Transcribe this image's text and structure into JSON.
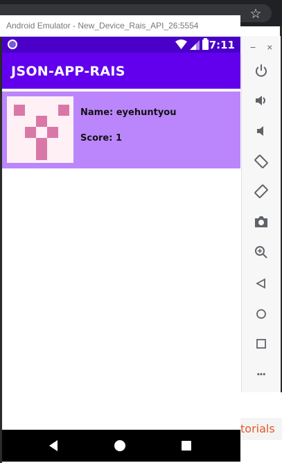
{
  "emulator": {
    "title": "Android Emulator - New_Device_Rais_API_26:5554"
  },
  "status_bar": {
    "time": "7:11"
  },
  "app": {
    "title": "JSON-APP-RAIS",
    "list": [
      {
        "name": "Name: eyehuntyou",
        "score": "Score: 1"
      }
    ]
  },
  "background_page": {
    "link_text": "torials"
  },
  "toolbar": {
    "minimize": "−",
    "close": "×",
    "more": "•••"
  },
  "colors": {
    "primary": "#6200ee",
    "primary_dark": "#4a00c8",
    "list_item_bg": "#bb86fc",
    "avatar_pink": "#d978a8"
  }
}
